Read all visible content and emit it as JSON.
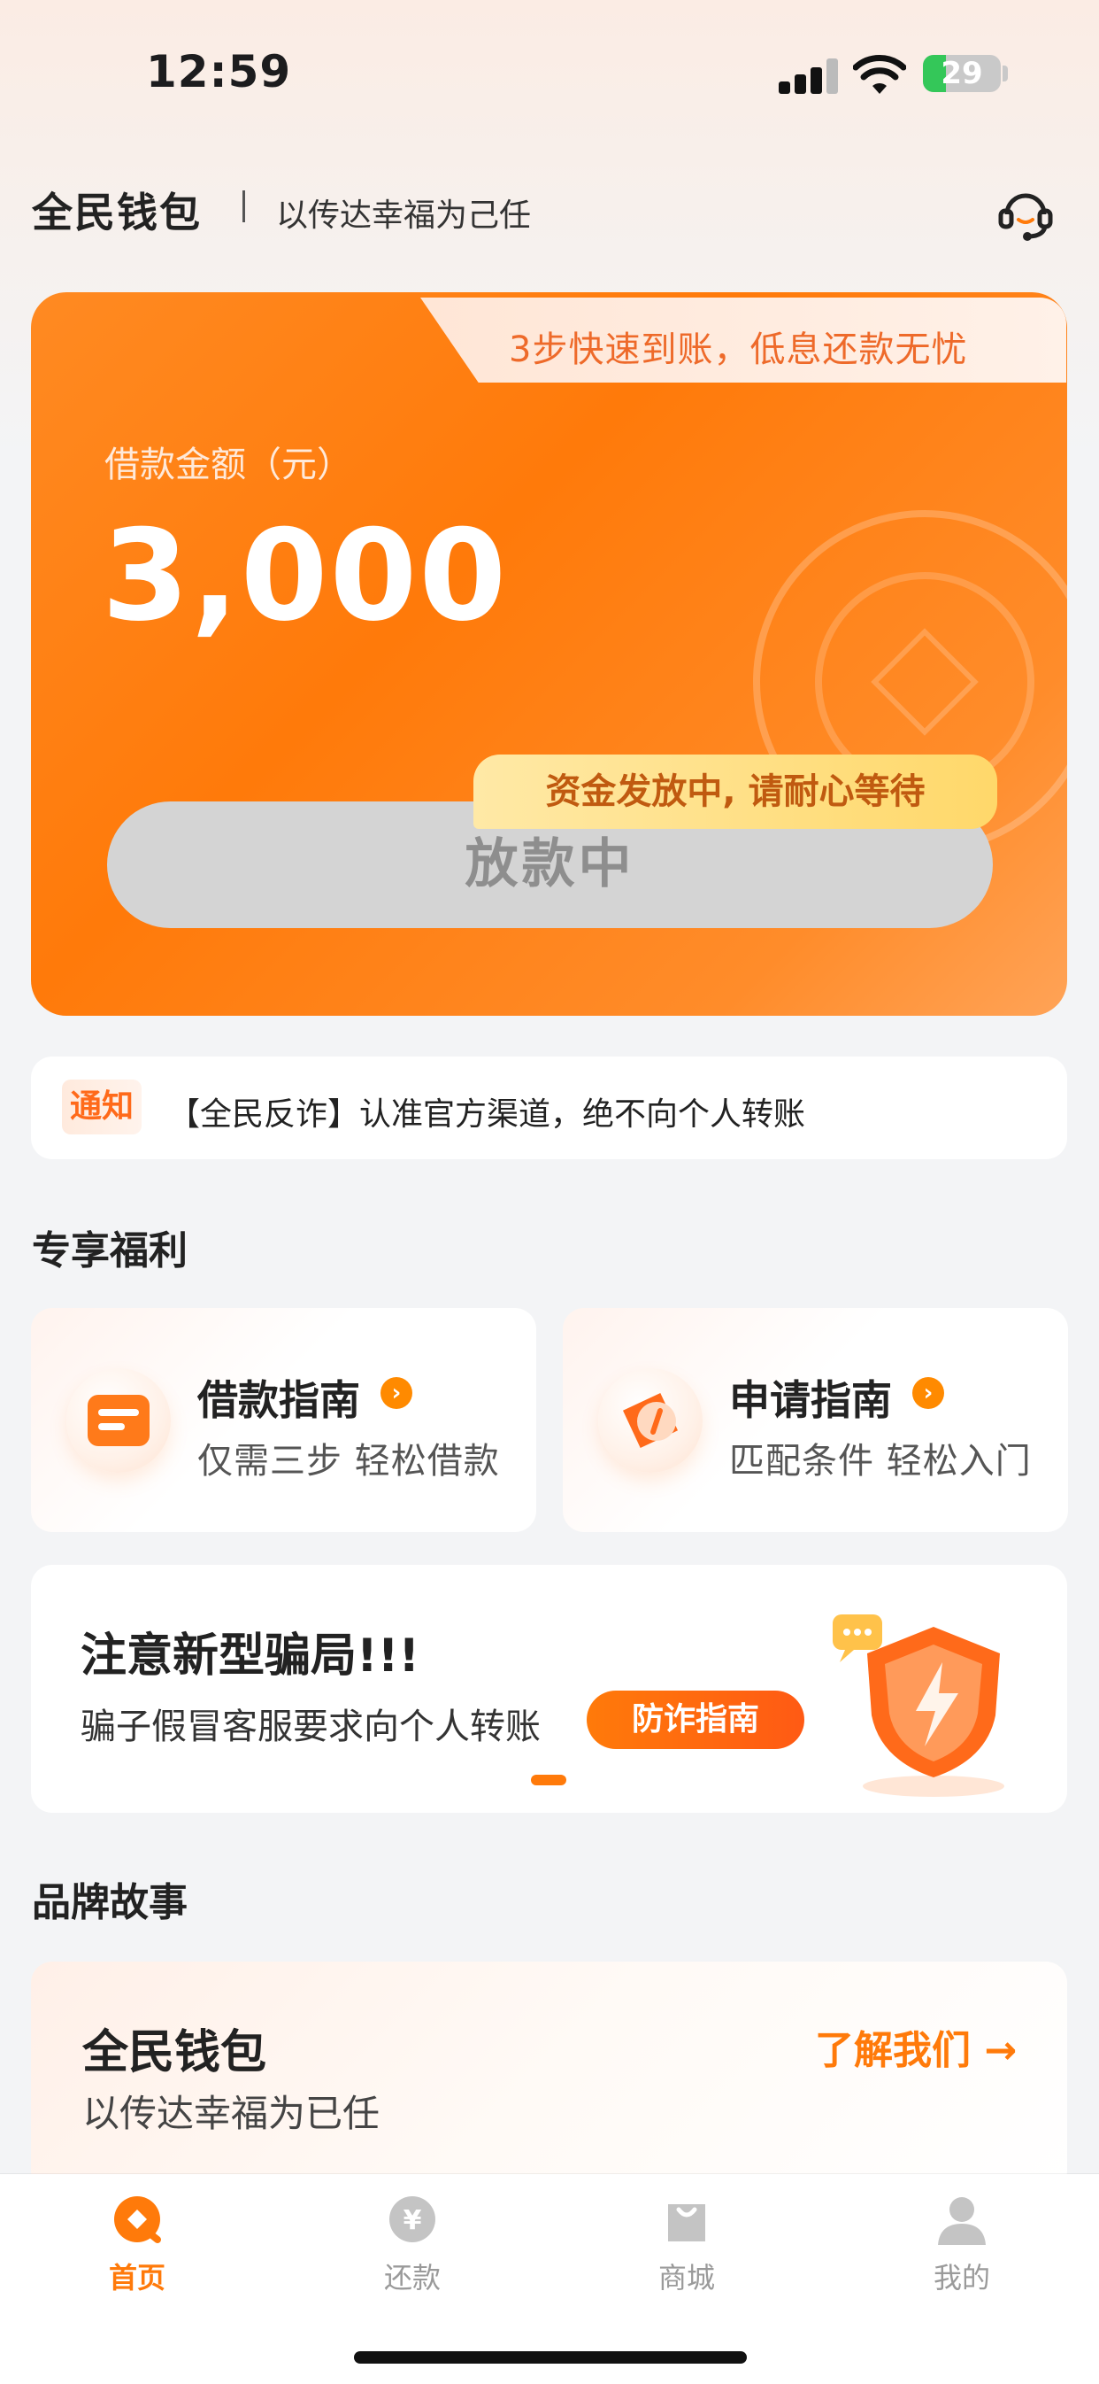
{
  "status_bar": {
    "time": "12:59",
    "battery": "29"
  },
  "header": {
    "brand": "全民钱包",
    "slogan": "以传达幸福为己任"
  },
  "loan_card": {
    "tab_text": "3步快速到账，低息还款无忧",
    "amount_label": "借款金额（元）",
    "amount": "3,000",
    "tooltip": "资金发放中, 请耐心等待",
    "button_label": "放款中"
  },
  "notice": {
    "tag": "通知",
    "text": "【全民反诈】认准官方渠道，绝不向个人转账"
  },
  "benefits": {
    "title": "专享福利",
    "items": [
      {
        "title": "借款指南",
        "subtitle": "仅需三步 轻松借款",
        "icon": "document-icon"
      },
      {
        "title": "申请指南",
        "subtitle": "匹配条件 轻松入门",
        "icon": "compass-icon"
      }
    ]
  },
  "fraud_banner": {
    "title": "注意新型骗局!!!",
    "description": "骗子假冒客服要求向个人转账",
    "button_label": "防诈指南"
  },
  "brand_story": {
    "title": "品牌故事",
    "card_title": "全民钱包",
    "card_subtitle": "以传达幸福为已任",
    "link_label": "了解我们 →"
  },
  "tabbar": {
    "items": [
      {
        "label": "首页",
        "icon": "home-icon",
        "active": true
      },
      {
        "label": "还款",
        "icon": "yuan-icon",
        "active": false
      },
      {
        "label": "商城",
        "icon": "shopping-bag-icon",
        "active": false
      },
      {
        "label": "我的",
        "icon": "profile-icon",
        "active": false
      }
    ]
  },
  "colors": {
    "accent": "#ff7a0a",
    "background": "#f3f4f6"
  }
}
